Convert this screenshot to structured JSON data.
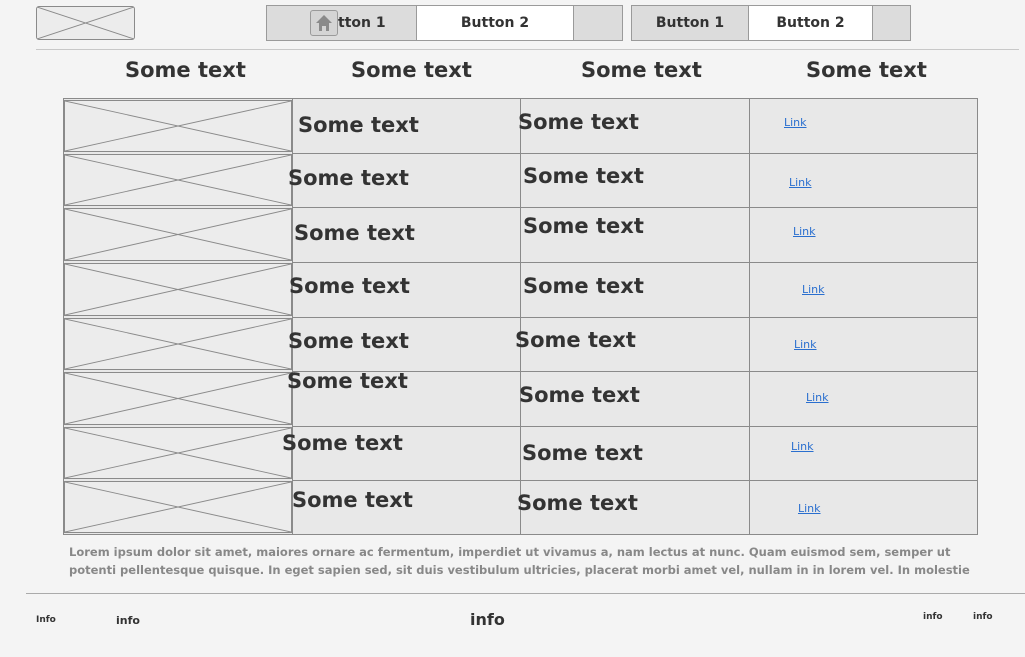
{
  "header": {
    "logo_alt": "logo placeholder",
    "group1": {
      "button1": "Button 1",
      "button2": "Button 2"
    },
    "group2": {
      "button1": "Button 1",
      "button2": "Button 2"
    }
  },
  "table": {
    "headers": [
      "Some text",
      "Some text",
      "Some text",
      "Some text"
    ],
    "rows": [
      {
        "col2": "Some text",
        "col3": "Some text",
        "link": "Link"
      },
      {
        "col2": "Some text",
        "col3": "Some text",
        "link": "Link"
      },
      {
        "col2": "Some text",
        "col3": "Some text",
        "link": "Link"
      },
      {
        "col2": "Some text",
        "col3": "Some text",
        "link": "Link"
      },
      {
        "col2": "Some text",
        "col3": "Some text",
        "link": "Link"
      },
      {
        "col2": "Some text",
        "col3": "Some text",
        "link": "Link"
      },
      {
        "col2": "Some text",
        "col3": "Some text",
        "link": "Link"
      },
      {
        "col2": "Some text",
        "col3": "Some text",
        "link": "Link"
      }
    ]
  },
  "body_text": "Lorem ipsum dolor sit amet, maiores ornare ac fermentum, imperdiet ut vivamus a, nam lectus at nunc. Quam euismod sem, semper ut potenti pellentesque quisque. In eget sapien sed, sit duis vestibulum ultricies, placerat morbi amet vel, nullam in in lorem vel. In molestie elit dui dictum, praesent nascetur pulvinar sed, in dolor pede in aliquam, risus nec error quis pharetra. Eros metus quam augue suspendisse, metus rutrum risus erat in. In ultrices quo ut lectus, etiam vestibulum urna a est, pretium luctus euismod nisl.",
  "footer": {
    "info1": "Info",
    "info2": "info",
    "info3": "info",
    "info4": "info",
    "info5": "info"
  }
}
